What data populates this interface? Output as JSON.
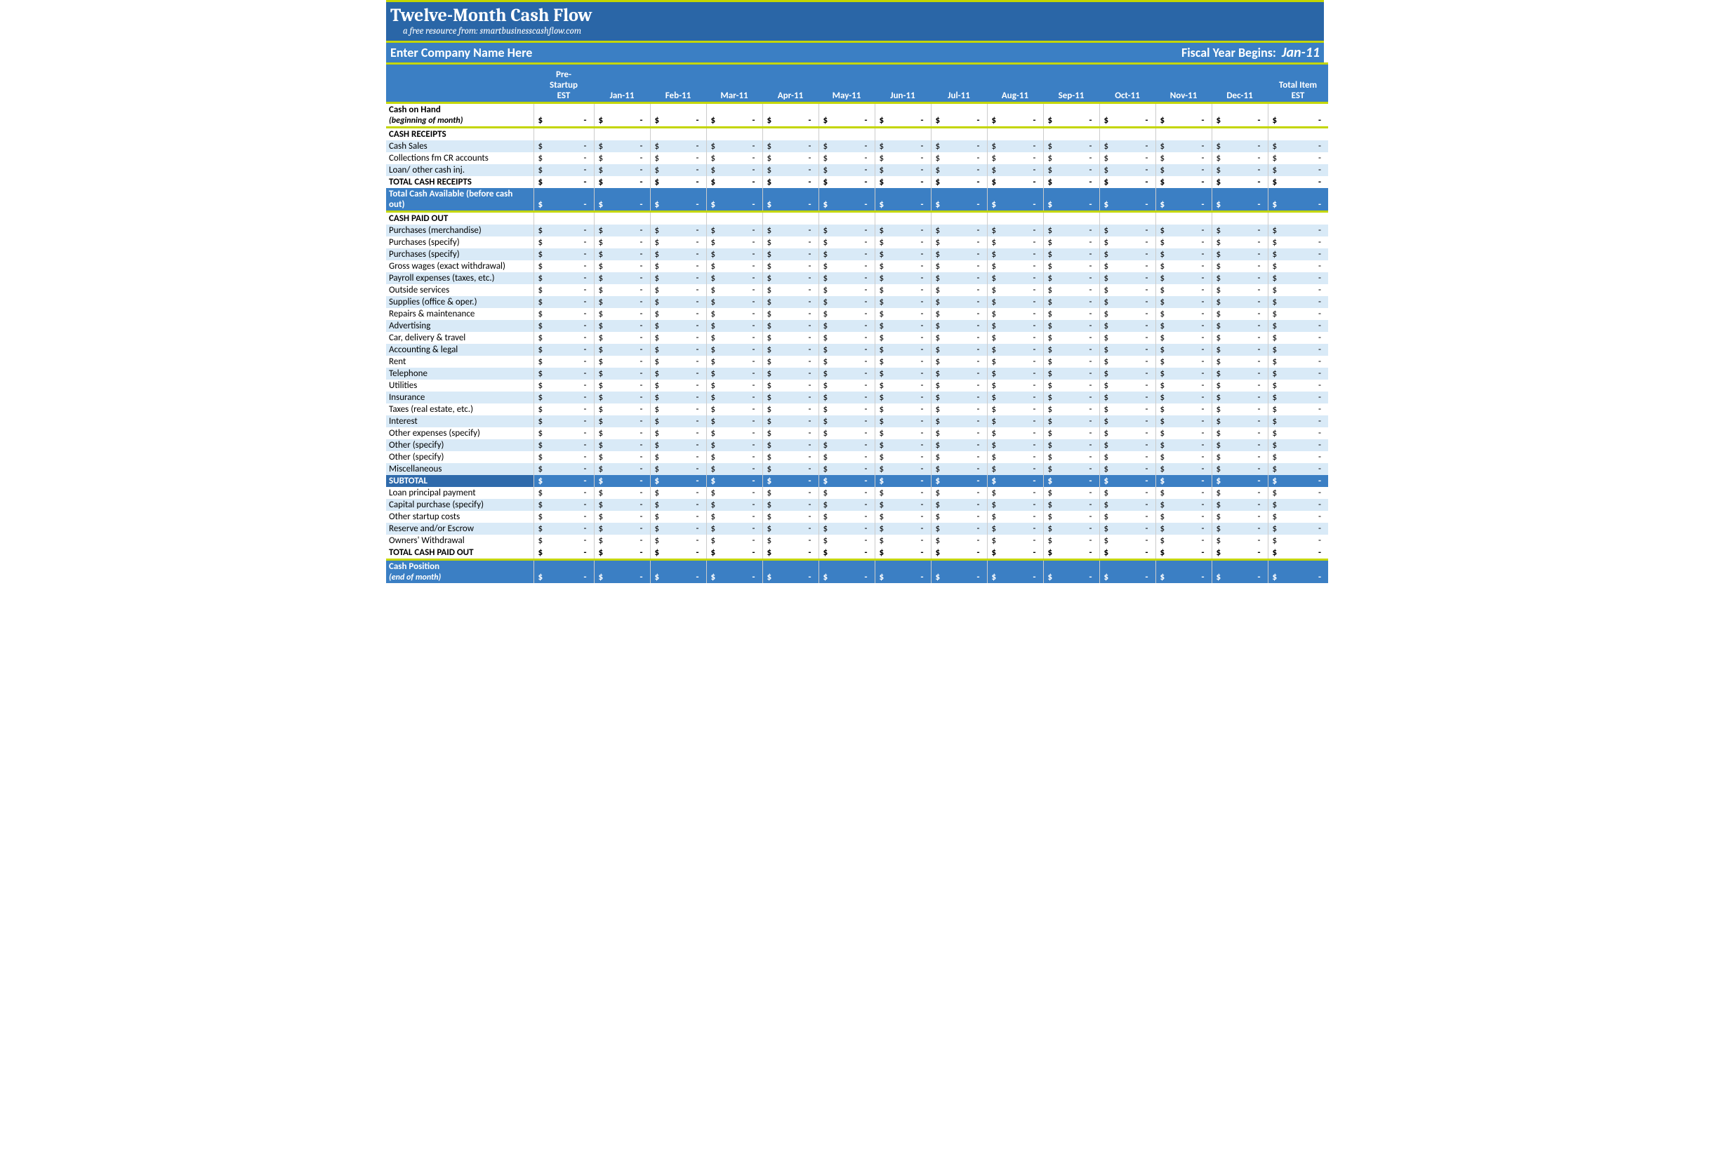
{
  "header": {
    "title": "Twelve-Month Cash Flow",
    "subtitle_prefix": "a free resource from:  ",
    "subtitle_site": "smartbusinesscashflow.com",
    "company_placeholder": "Enter Company Name Here",
    "fiscal_label": "Fiscal Year Begins:",
    "fiscal_date": "Jan-11"
  },
  "columns": [
    "Pre-Startup EST",
    "Jan-11",
    "Feb-11",
    "Mar-11",
    "Apr-11",
    "May-11",
    "Jun-11",
    "Jul-11",
    "Aug-11",
    "Sep-11",
    "Oct-11",
    "Nov-11",
    "Dec-11",
    "Total Item EST"
  ],
  "currency": "$",
  "dash": "-",
  "rows": {
    "cash_on_hand_label": "Cash on Hand",
    "cash_on_hand_sub": "(beginning of month)",
    "cash_receipts_header": "CASH RECEIPTS",
    "cash_receipts": [
      "Cash Sales",
      "Collections fm CR accounts",
      "Loan/ other cash inj."
    ],
    "total_cash_receipts": "TOTAL CASH RECEIPTS",
    "total_cash_available": "Total Cash Available (before cash out)",
    "cash_paid_out_header": "CASH PAID OUT",
    "cash_paid_out": [
      "Purchases (merchandise)",
      "Purchases (specify)",
      "Purchases (specify)",
      "Gross wages (exact withdrawal)",
      "Payroll expenses (taxes, etc.)",
      "Outside services",
      "Supplies (office & oper.)",
      "Repairs & maintenance",
      "Advertising",
      "Car, delivery & travel",
      "Accounting & legal",
      "Rent",
      "Telephone",
      "Utilities",
      "Insurance",
      "Taxes (real estate, etc.)",
      "Interest",
      "Other expenses (specify)",
      "Other (specify)",
      "Other (specify)",
      "Miscellaneous"
    ],
    "subtotal": "SUBTOTAL",
    "post_subtotal": [
      "Loan principal payment",
      "Capital purchase (specify)",
      "Other startup costs",
      "Reserve and/or Escrow",
      "Owners' Withdrawal"
    ],
    "total_cash_paid_out": "TOTAL CASH PAID OUT",
    "cash_position_label": "Cash Position",
    "cash_position_sub": "(end of month)"
  }
}
